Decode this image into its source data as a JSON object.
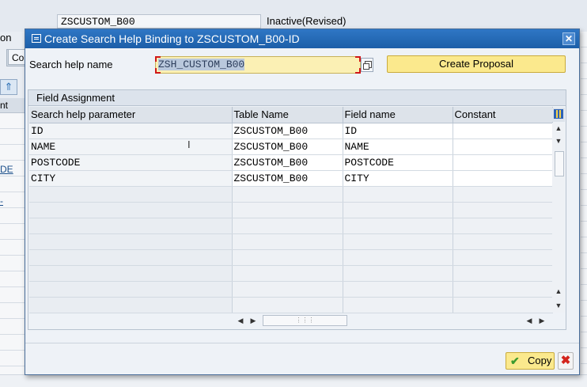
{
  "background": {
    "field_value": "ZSCUSTOM_B00",
    "status": "Inactive(Revised)",
    "left_label": "on",
    "tab_label": "Co",
    "grid_header": "nt",
    "link1": "DE",
    "link2": "-"
  },
  "dialog": {
    "title": "Create Search Help Binding to ZSCUSTOM_B00-ID",
    "search_help_label": "Search help name",
    "search_help_value": "ZSH_CUSTOM_B00",
    "create_proposal_label": "Create Proposal",
    "field_assignment_title": "Field Assignment",
    "columns": [
      "Search help parameter",
      "Table Name",
      "Field name",
      "Constant"
    ],
    "rows": [
      [
        "ID",
        "ZSCUSTOM_B00",
        "ID",
        ""
      ],
      [
        "NAME",
        "ZSCUSTOM_B00",
        "NAME",
        ""
      ],
      [
        "POSTCODE",
        "ZSCUSTOM_B00",
        "POSTCODE",
        ""
      ],
      [
        "CITY",
        "ZSCUSTOM_B00",
        "CITY",
        ""
      ]
    ],
    "empty_rows": 8,
    "copy_label": "Copy",
    "accent_color": "#1c5ea8",
    "button_color": "#fbe98d",
    "input_color": "#fbf0b4"
  }
}
